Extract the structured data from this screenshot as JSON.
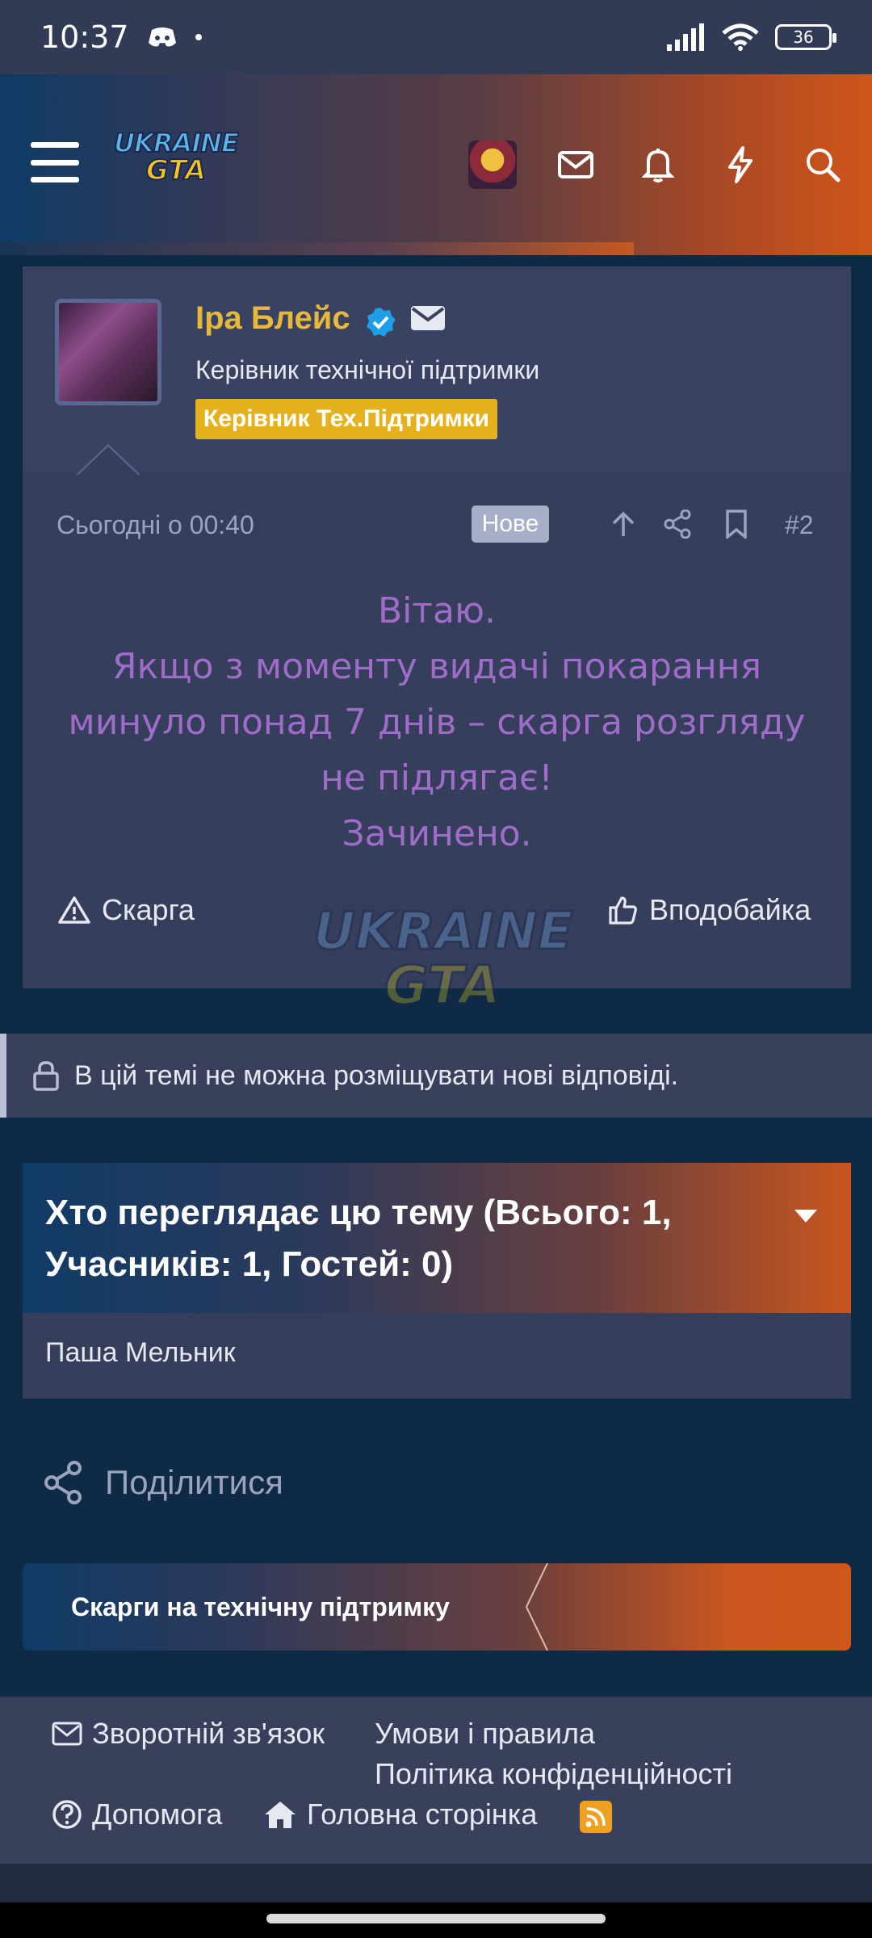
{
  "status_bar": {
    "time": "10:37",
    "battery": "36"
  },
  "header": {
    "logo_top": "UKRAINE",
    "logo_bottom": "GTA",
    "icons": [
      "menu-icon",
      "avatar",
      "envelope-icon",
      "bell-icon",
      "bolt-icon",
      "search-icon"
    ]
  },
  "post": {
    "username": "Іра Блейс",
    "user_title": "Керівник технічної підтримки",
    "user_banner": "Керівник Тех.Підтримки",
    "date": "Сьогодні о 00:40",
    "badge": "Нове",
    "number": "#2",
    "body": [
      "Вітаю.",
      "Якщо з моменту видачі покарання",
      "минуло понад 7 днів – скарга розгляду",
      "не підлягає!",
      "Зачинено."
    ],
    "report_label": "Скарга",
    "like_label": "Вподобайка",
    "watermark_top": "UKRAINE",
    "watermark_bottom": "GTA"
  },
  "locked_notice": "В цій темі не можна розміщувати нові відповіді.",
  "viewers": {
    "title": "Хто переглядає цю тему (Всього: 1, Учасників: 1, Гостей: 0)",
    "members": "Паша Мельник"
  },
  "share_label": "Поділитися",
  "breadcrumb": "Скарги на технічну підтримку",
  "footer": {
    "contact": "Зворотній зв'язок",
    "terms": "Умови і правила",
    "privacy": "Політика конфіденційності",
    "help": "Допомога",
    "home": "Головна сторінка"
  },
  "colors": {
    "accent_orange": "#d0561a",
    "username_gold": "#e8b83a",
    "banner_gold": "#e5b21e",
    "post_text_purple": "#9f6dc9"
  }
}
